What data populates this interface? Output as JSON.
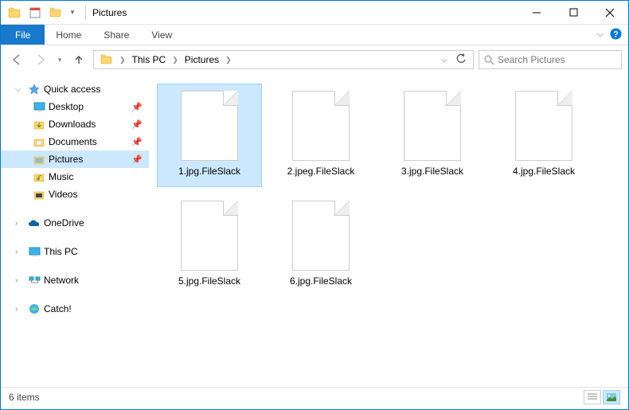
{
  "title": "Pictures",
  "ribbon": {
    "file": "File",
    "home": "Home",
    "share": "Share",
    "view": "View"
  },
  "breadcrumb": {
    "root": "This PC",
    "current": "Pictures"
  },
  "search": {
    "placeholder": "Search Pictures"
  },
  "sidebar": {
    "quick_access": "Quick access",
    "desktop": "Desktop",
    "downloads": "Downloads",
    "documents": "Documents",
    "pictures": "Pictures",
    "music": "Music",
    "videos": "Videos",
    "onedrive": "OneDrive",
    "this_pc": "This PC",
    "network": "Network",
    "catch": "Catch!"
  },
  "files": [
    {
      "name": "1.jpg.FileSlack"
    },
    {
      "name": "2.jpeg.FileSlack"
    },
    {
      "name": "3.jpg.FileSlack"
    },
    {
      "name": "4.jpg.FileSlack"
    },
    {
      "name": "5.jpg.FileSlack"
    },
    {
      "name": "6.jpg.FileSlack"
    }
  ],
  "status": {
    "count": "6 items"
  }
}
